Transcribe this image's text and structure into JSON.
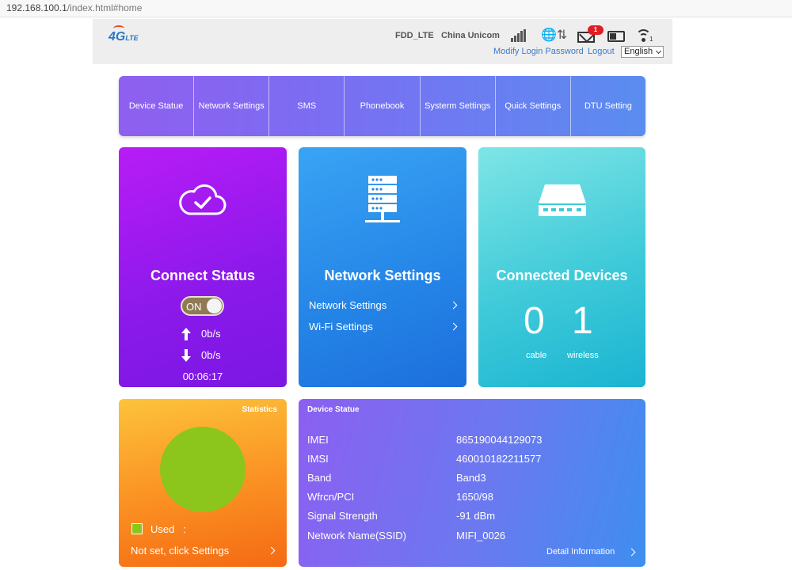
{
  "browser": {
    "url_host": "192.168.100.1",
    "url_path": "/index.html#home"
  },
  "header": {
    "logo_text": "4G",
    "logo_sub": "LTE",
    "network_type": "FDD_LTE",
    "operator": "China Unicom",
    "sms_count": "1",
    "wifi_clients": "1",
    "modify_password": "Modify Login Password",
    "logout": "Logout",
    "language": "English"
  },
  "nav": {
    "items": [
      "Device Statue",
      "Network Settings",
      "SMS",
      "Phonebook",
      "Systerm Settings",
      "Quick Settings",
      "DTU Setting"
    ]
  },
  "connect": {
    "title": "Connect Status",
    "toggle_label": "ON",
    "upload": "0b/s",
    "download": "0b/s",
    "duration": "00:06:17"
  },
  "network": {
    "title": "Network Settings",
    "links": [
      "Network Settings",
      "Wi-Fi Settings"
    ]
  },
  "devices": {
    "title": "Connected Devices",
    "cable_count": "0",
    "wireless_count": "1",
    "cable_label": "cable",
    "wireless_label": "wireless"
  },
  "statistics": {
    "title": "Statistics",
    "used_label": "Used   :",
    "settings_link": "Not set, click Settings"
  },
  "device_status": {
    "title": "Device Statue",
    "rows": [
      {
        "key": "IMEI",
        "value": "865190044129073"
      },
      {
        "key": "IMSI",
        "value": "460010182211577"
      },
      {
        "key": "Band",
        "value": "Band3"
      },
      {
        "key": "Wfrcn/PCI",
        "value": "1650/98"
      },
      {
        "key": "Signal Strength",
        "value": "-91 dBm"
      },
      {
        "key": "Network Name(SSID)",
        "value": "MIFI_0026"
      }
    ],
    "detail_link": "Detail Information"
  },
  "colors": {
    "connect_card": "#9a1aef",
    "network_card": "#2a8ae8",
    "devices_card": "#3fcad9",
    "statistics_card": "#fb9424",
    "status_card": "#6a79f0",
    "pie_used": "#8cc61d",
    "sms_badge": "#e31b23"
  },
  "icons": [
    "cloud-check-icon",
    "server-icon",
    "router-icon",
    "signal-bars-icon",
    "globe-transfer-icon",
    "mail-icon",
    "sim-icon",
    "wifi-icon"
  ]
}
